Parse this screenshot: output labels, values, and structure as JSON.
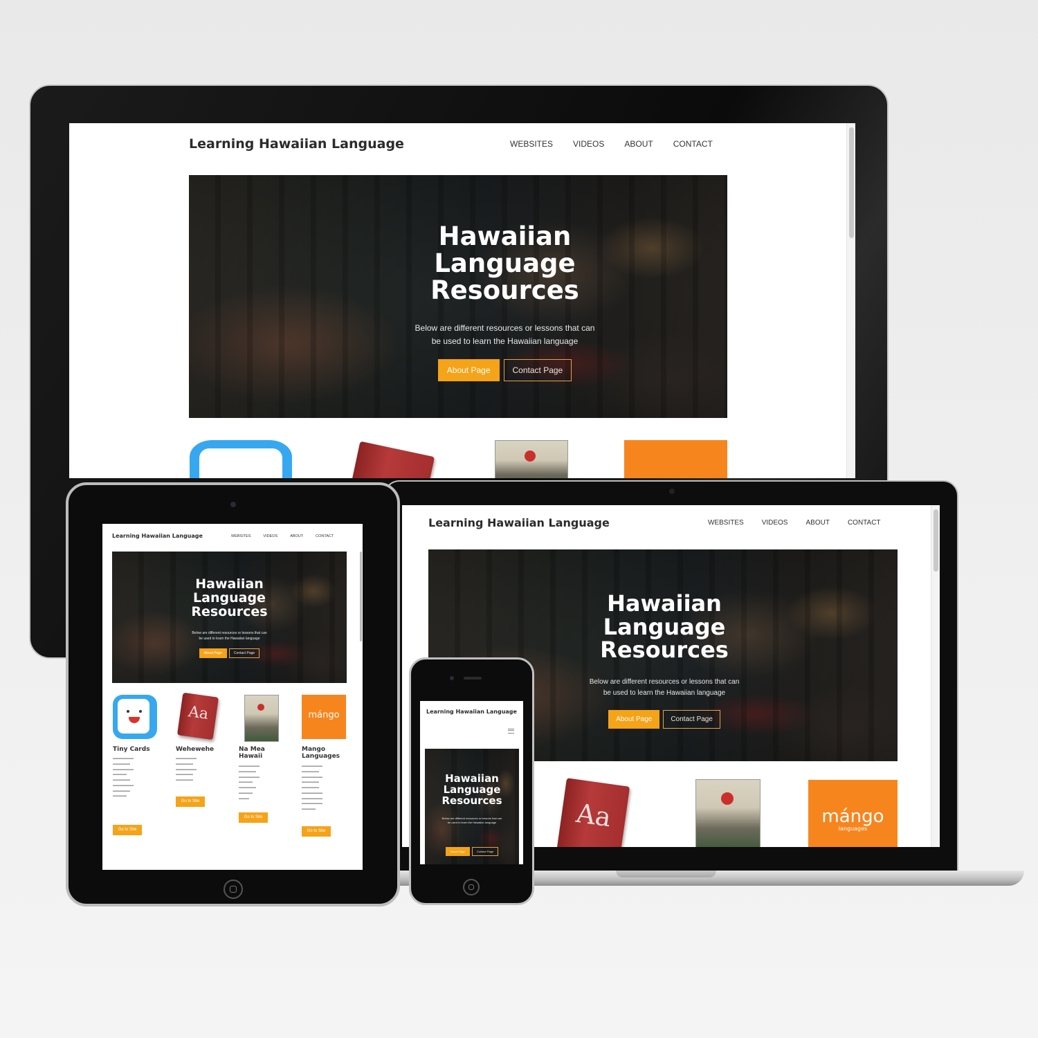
{
  "site": {
    "brand": "Learning Hawaiian Language",
    "nav": [
      "WEBSITES",
      "VIDEOS",
      "ABOUT",
      "CONTACT"
    ],
    "hero": {
      "title_lines": [
        "Hawaiian",
        "Language",
        "Resources"
      ],
      "subtitle_lines": [
        "Below are different resources or lessons that can",
        "be used to learn the Hawaiian language"
      ],
      "primary_button": "About Page",
      "secondary_button": "Contact Page"
    },
    "resources": [
      {
        "title": "Tiny Cards",
        "button": "Go to Site"
      },
      {
        "title": "Wehewehe",
        "button": "Go to Site"
      },
      {
        "title": "Na Mea Hawaii",
        "button": "Go to Site"
      },
      {
        "title": "Mango Languages",
        "button": "Go to Site"
      }
    ],
    "book_label": "Aa",
    "mango_logo": "mángo",
    "mango_sub": "languages"
  },
  "colors": {
    "accent": "#f5a318",
    "mango_orange": "#f7851e",
    "tinycards_blue": "#37a8ef",
    "book_red": "#a52e2e"
  }
}
